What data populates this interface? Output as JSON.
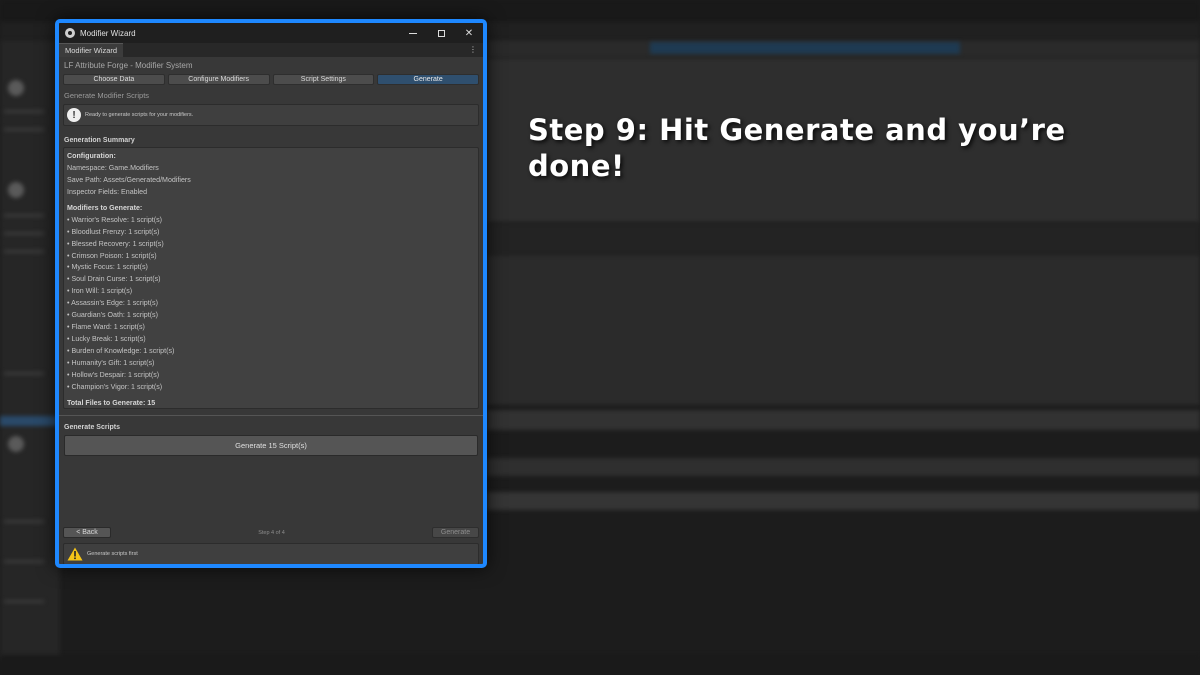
{
  "window": {
    "title": "Modifier Wizard",
    "tab_label": "Modifier Wizard",
    "more_glyph": "⋮",
    "close_glyph": "✕"
  },
  "wizard": {
    "title": "LF Attribute Forge - Modifier System",
    "steps": [
      "Choose Data",
      "Configure Modifiers",
      "Script Settings",
      "Generate"
    ],
    "active_step": "Generate",
    "section_title": "Generate Modifier Scripts",
    "info_message": "Ready to generate scripts for your modifiers."
  },
  "summary": {
    "label": "Generation Summary",
    "config_heading": "Configuration:",
    "namespace": "Namespace: Game.Modifiers",
    "save_path": "Save Path: Assets/Generated/Modifiers",
    "inspector": "Inspector Fields: Enabled",
    "modifiers_heading": "Modifiers to Generate:",
    "modifiers": [
      "• Warrior's Resolve: 1 script(s)",
      "• Bloodlust Frenzy: 1 script(s)",
      "• Blessed Recovery: 1 script(s)",
      "• Crimson Poison: 1 script(s)",
      "• Mystic Focus: 1 script(s)",
      "• Soul Drain Curse: 1 script(s)",
      "• Iron Will: 1 script(s)",
      "• Assassin's Edge: 1 script(s)",
      "• Guardian's Oath: 1 script(s)",
      "• Flame Ward: 1 script(s)",
      "• Lucky Break: 1 script(s)",
      "• Burden of Knowledge: 1 script(s)",
      "• Humanity's Gift: 1 script(s)",
      "• Hollow's Despair: 1 script(s)",
      "• Champion's Vigor: 1 script(s)"
    ],
    "total": "Total Files to Generate: 15"
  },
  "generate": {
    "label": "Generate Scripts",
    "button": "Generate 15 Script(s)"
  },
  "nav": {
    "back": "< Back",
    "step_indicator": "Step 4 of 4",
    "generate": "Generate"
  },
  "warning": "Generate scripts first",
  "caption": "Step 9: Hit Generate and you’re done!",
  "colors": {
    "accent_border": "#1e88ff",
    "active_tab": "#2f4f6e",
    "warning": "#f5c518"
  }
}
